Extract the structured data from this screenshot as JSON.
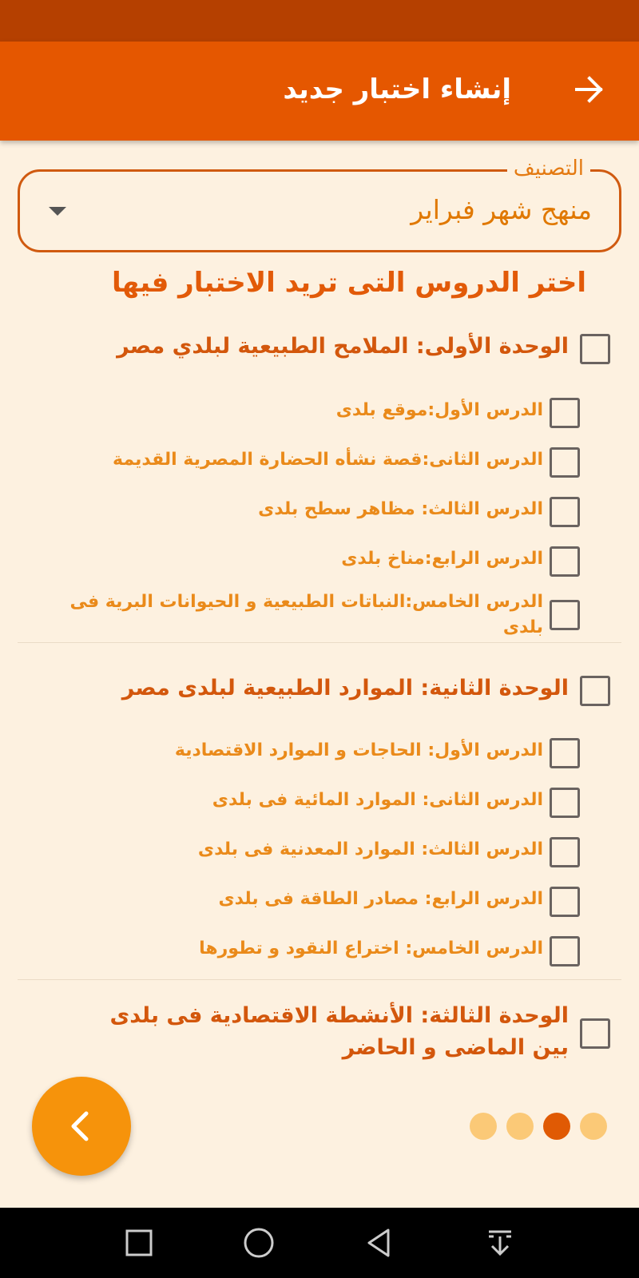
{
  "app_bar": {
    "title": "إنشاء اختبار جديد",
    "back_icon": "arrow-right-icon"
  },
  "category": {
    "label": "التصنيف",
    "value": "منهج شهر فبراير"
  },
  "lessons_prompt": "اختر الدروس التى تريد الاختبار فيها",
  "units": [
    {
      "title": "الوحدة الأولى: الملامح الطبيعية لبلدي مصر",
      "checked": false,
      "lessons": [
        {
          "title": "الدرس الأول:موقع بلدى",
          "checked": false
        },
        {
          "title": "الدرس الثانى:قصة نشأه الحضارة المصرية القديمة",
          "checked": false
        },
        {
          "title": "الدرس الثالث: مظاهر سطح بلدى",
          "checked": false
        },
        {
          "title": "الدرس الرابع:مناخ بلدى",
          "checked": false
        },
        {
          "title": "الدرس الخامس:النباتات الطبيعية و الحيوانات البرية فى بلدى",
          "checked": false
        }
      ]
    },
    {
      "title": "الوحدة الثانية: الموارد الطبيعية لبلدى مصر",
      "checked": false,
      "lessons": [
        {
          "title": "الدرس الأول: الحاجات و الموارد الاقتصادية",
          "checked": false
        },
        {
          "title": "الدرس الثانى: الموارد المائية فى بلدى",
          "checked": false
        },
        {
          "title": "الدرس الثالث: الموارد المعدنية فى بلدى",
          "checked": false
        },
        {
          "title": "الدرس الرابع: مصادر الطاقة فى بلدى",
          "checked": false
        },
        {
          "title": "الدرس الخامس: اختراع النقود و تطورها",
          "checked": false
        }
      ]
    },
    {
      "title": "الوحدة الثالثة: الأنشطة الاقتصادية فى بلدى بين الماضى و الحاضر",
      "checked": false,
      "lessons": []
    }
  ],
  "pager": {
    "total_pages": 4,
    "current_page": 3
  },
  "fab_icon": "chevron-left-icon",
  "colors": {
    "status_bar": "#b54000",
    "app_bar": "#e55700",
    "background": "#fdf1e0",
    "accent": "#f6930b",
    "unit_text": "#d3570c",
    "lesson_text": "#ea8a1a"
  },
  "system_nav": [
    "square-icon",
    "circle-icon",
    "triangle-back-icon",
    "download-icon"
  ]
}
